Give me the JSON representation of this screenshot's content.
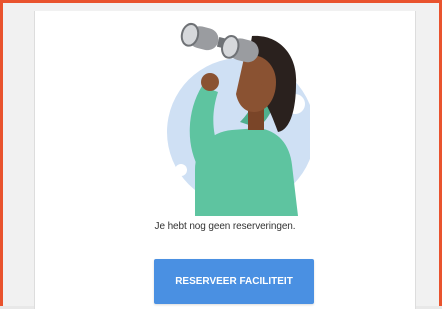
{
  "empty_state": {
    "illustration": "person-with-binoculars-illustration",
    "message": "Je hebt nog geen reserveringen.",
    "button_label": "RESERVEER FACILITEIT"
  },
  "colors": {
    "frame_border": "#e9532e",
    "button": "#4a90e2",
    "illustration_circle": "#cfe0f4",
    "shirt": "#5ec4a0",
    "skin": "#8a5232",
    "hair": "#2a211e"
  }
}
